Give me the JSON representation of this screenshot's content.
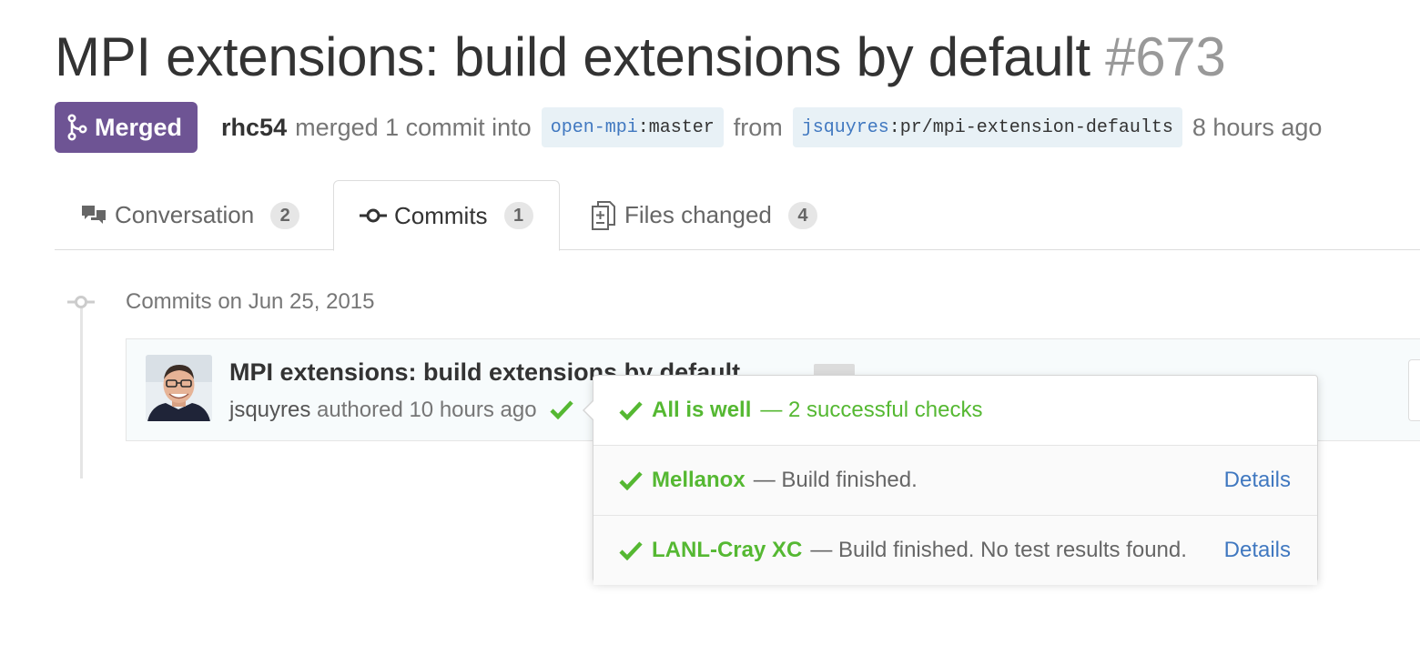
{
  "pr": {
    "title": "MPI extensions: build extensions by default",
    "number": "#673",
    "state": "Merged",
    "author": "rhc54",
    "action": "merged 1 commit into",
    "base_user": "open-mpi",
    "base_branch": "master",
    "from_word": "from",
    "head_user": "jsquyres",
    "head_branch": "pr/mpi-extension-defaults",
    "time": "8 hours ago"
  },
  "tabs": [
    {
      "label": "Conversation",
      "count": "2",
      "icon": "comment-discussion-icon",
      "selected": false
    },
    {
      "label": "Commits",
      "count": "1",
      "icon": "git-commit-icon",
      "selected": true
    },
    {
      "label": "Files changed",
      "count": "4",
      "icon": "diff-icon",
      "selected": false
    }
  ],
  "commit_group": {
    "title": "Commits on Jun 25, 2015",
    "commits": [
      {
        "title": "MPI extensions: build extensions by default",
        "ellipsis": "…",
        "author": "jsquyres",
        "authored": "authored 10 hours ago"
      }
    ]
  },
  "status_popover": {
    "summary_strong": "All is well",
    "summary_rest": "— 2 successful checks",
    "checks": [
      {
        "name": "Mellanox",
        "description": "— Build finished.",
        "link": "Details"
      },
      {
        "name": "LANL-Cray XC",
        "description": "— Build finished. No test results found.",
        "link": "Details"
      }
    ]
  },
  "colors": {
    "merged": "#6e5494",
    "success": "#55b832",
    "link": "#4078c0",
    "branch_bg": "#e8f1f6"
  }
}
